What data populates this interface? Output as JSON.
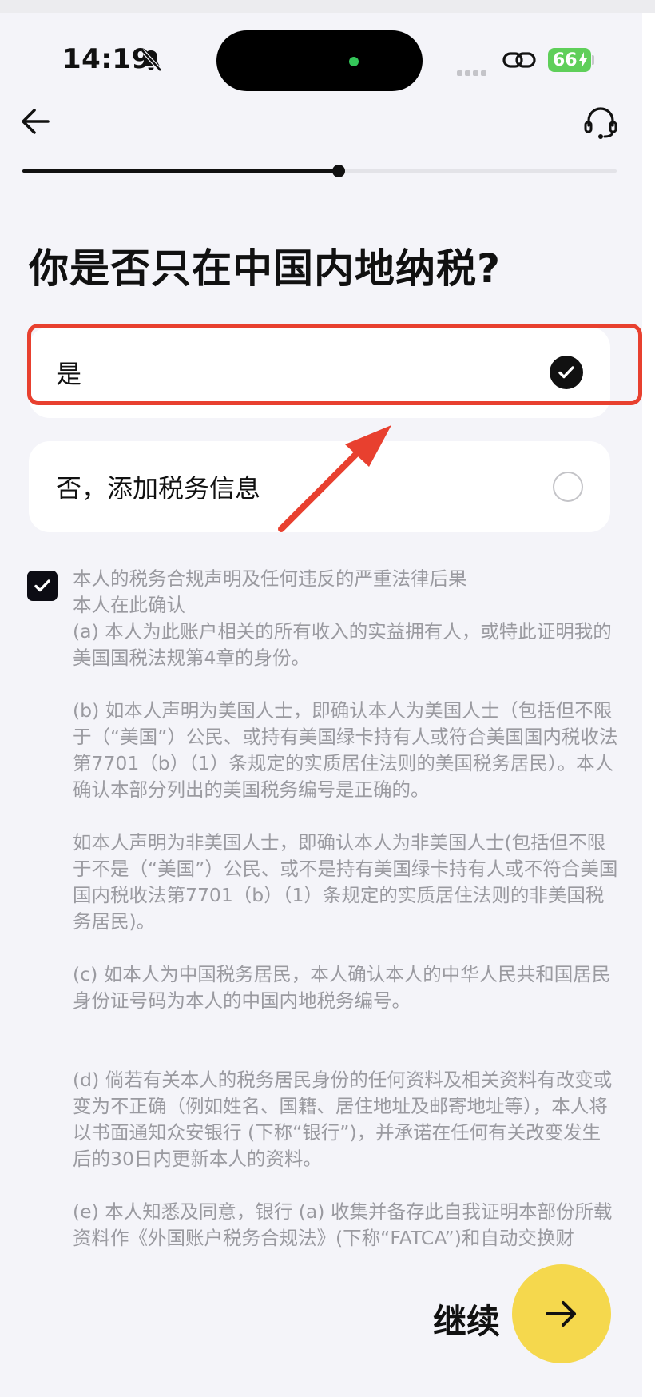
{
  "status_bar": {
    "time": "14:19",
    "battery": "66"
  },
  "header": {
    "progress_fraction": 0.532
  },
  "question": "你是否只在中国内地纳税?",
  "options": [
    {
      "label": "是",
      "selected": true
    },
    {
      "label": "否，添加税务信息",
      "selected": false
    }
  ],
  "consent": {
    "checked": true,
    "paragraphs": [
      "本人的税务合规声明及任何违反的严重法律后果",
      "本人在此确认",
      "(a) 本人为此账户相关的所有收入的实益拥有人，或特此证明我的美国国税法规第4章的身份。",
      "(b) 如本人声明为美国人士，即确认本人为美国人士（包括但不限于（“美国”）公民、或持有美国绿卡持有人或符合美国国内税收法第7701（b）（1）条规定的实质居住法则的美国税务居民）。本人确认本部分列出的美国税务编号是正确的。",
      "如本人声明为非美国人士，即确认本人为非美国人士(包括但不限于不是（“美国”）公民、或不是持有美国绿卡持有人或不符合美国国内税收法第7701（b）（1）条规定的实质居住法则的非美国税务居民)。",
      "(c) 如本人为中国税务居民，本人确认本人的中华人民共和国居民身份证号码为本人的中国内地税务编号。",
      "(d) 倘若有关本人的税务居民身份的任何资料及相关资料有改变或变为不正确（例如姓名、国籍、居住地址及邮寄地址等），本人将以书面通知众安银行 (下称“银行”)，并承诺在任何有关改变发生后的30日内更新本人的资料。",
      "(e) 本人知悉及同意，银行 (a) 收集并备存此自我证明本部份所载资料作《外国账户税务合规法》(下称“FATCA”)和自动交换财"
    ]
  },
  "footer": {
    "continue_label": "继续"
  },
  "colors": {
    "accent_yellow": "#f5d84d",
    "annotation_red": "#e8402f",
    "text_muted": "#9a9aa0"
  }
}
